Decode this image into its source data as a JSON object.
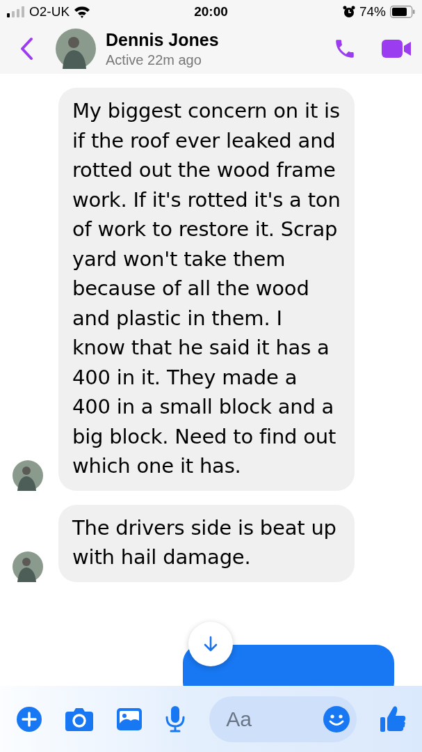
{
  "status_bar": {
    "carrier": "O2-UK",
    "time": "20:00",
    "battery": "74%"
  },
  "header": {
    "name": "Dennis Jones",
    "status": "Active 22m ago"
  },
  "messages": [
    {
      "kind": "incoming",
      "text": "My biggest concern on it is if the roof ever leaked and rotted out the wood frame work. If it's rotted it's a ton of work to restore it. Scrap yard won't take them because of all the wood and plastic in them. I know that he said it has a 400 in it. They made a 400 in a small block and a big block. Need to find out which one it has."
    },
    {
      "kind": "incoming",
      "text": "The drivers side is beat up with hail damage."
    },
    {
      "kind": "outgoing"
    }
  ],
  "composer": {
    "placeholder": "Aa"
  }
}
